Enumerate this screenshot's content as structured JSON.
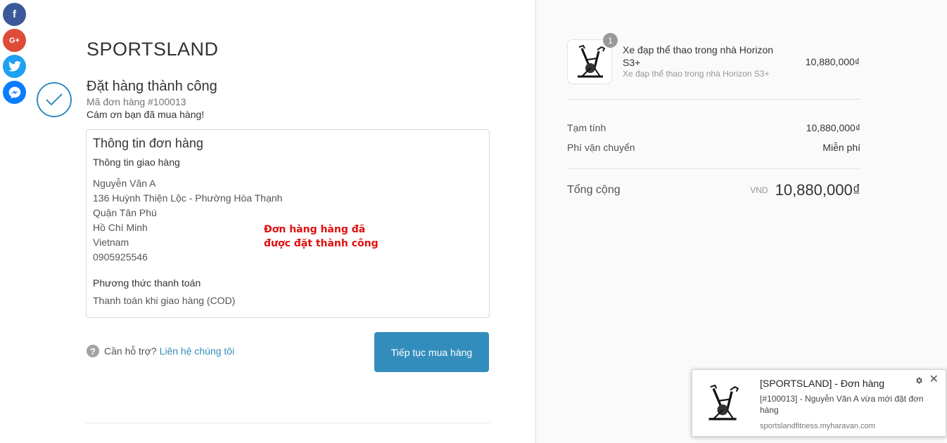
{
  "social": {
    "facebook": "f",
    "googleplus": "G+",
    "icons": [
      "facebook-icon",
      "google-plus-icon",
      "twitter-icon",
      "messenger-icon"
    ]
  },
  "brand": "SPORTSLAND",
  "success": {
    "title": "Đặt hàng thành công",
    "order_code": "Mã đơn hàng #100013",
    "thanks": "Cám ơn bạn đã mua hàng!"
  },
  "order_info": {
    "heading": "Thông tin đơn hàng",
    "shipping_heading": "Thông tin giao hàng",
    "name": "Nguyễn Văn A",
    "street": "136 Huỳnh Thiện Lộc - Phường Hòa Thạnh",
    "district": "Quận Tân Phú",
    "city": "Hồ Chí Minh",
    "country": "Vietnam",
    "phone": "0905925546",
    "payment_heading": "Phương thức thanh toán",
    "payment_method": "Thanh toán khi giao hàng (COD)"
  },
  "annotation": {
    "line1": "Đơn hàng hàng đã",
    "line2": "được đặt thành công"
  },
  "help": {
    "icon": "?",
    "text": "Cần hỗ trợ?",
    "link": "Liên hệ chúng tôi"
  },
  "continue_button": "Tiếp tục mua hàng",
  "summary": {
    "product": {
      "quantity": "1",
      "name": "Xe đạp thể thao trong nhà Horizon S3+",
      "variant": "Xe đạp thể thao trong nhà Horizon S3+",
      "price": "10,880,000₫"
    },
    "subtotal_label": "Tạm tính",
    "subtotal_value": "10,880,000₫",
    "shipping_label": "Phí vận chuyển",
    "shipping_value": "Miễn phí",
    "total_label": "Tổng cộng",
    "currency": "VND",
    "total_value": "10,880,000₫"
  },
  "notification": {
    "title": "[SPORTSLAND] - Đơn hàng",
    "body": "[#100013] - Nguyễn Văn A vừa mới đặt đơn hàng",
    "source": "sportslandfitness.myharavan.com",
    "close": "✕"
  },
  "colors": {
    "accent": "#338dbc",
    "annotation": "#e00f0f",
    "facebook": "#3b5998",
    "googleplus": "#dd4b39",
    "twitter": "#1da1f2",
    "messenger": "#0a7cff"
  }
}
